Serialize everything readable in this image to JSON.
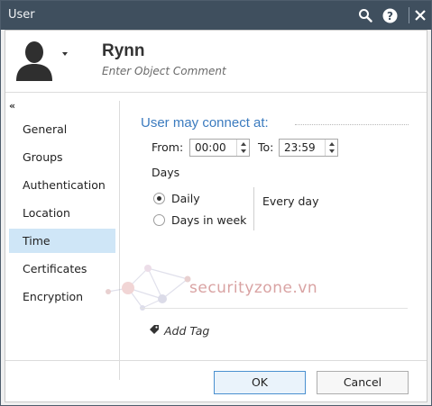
{
  "window": {
    "title": "User"
  },
  "titlebar_icons": [
    "search-icon",
    "help-icon",
    "close-icon"
  ],
  "header": {
    "name": "Rynn",
    "comment_placeholder": "Enter Object Comment"
  },
  "nav": {
    "items": [
      {
        "label": "General",
        "active": false
      },
      {
        "label": "Groups",
        "active": false
      },
      {
        "label": "Authentication",
        "active": false
      },
      {
        "label": "Location",
        "active": false
      },
      {
        "label": "Time",
        "active": true
      },
      {
        "label": "Certificates",
        "active": false
      },
      {
        "label": "Encryption",
        "active": false
      }
    ]
  },
  "time": {
    "section_title": "User may connect at:",
    "from_label": "From:",
    "from_value": "00:00",
    "to_label": "To:",
    "to_value": "23:59",
    "days_label": "Days",
    "options": [
      {
        "label": "Daily",
        "checked": true
      },
      {
        "label": "Days in week",
        "checked": false
      }
    ],
    "summary": "Every day"
  },
  "watermark": {
    "text": "securityzone.vn"
  },
  "tag": {
    "label": "Add Tag"
  },
  "footer": {
    "ok_label": "OK",
    "cancel_label": "Cancel"
  },
  "colors": {
    "titlebar": "#3f4f5e",
    "accent": "#3b7bbf",
    "nav_active": "#cfe6f7"
  }
}
